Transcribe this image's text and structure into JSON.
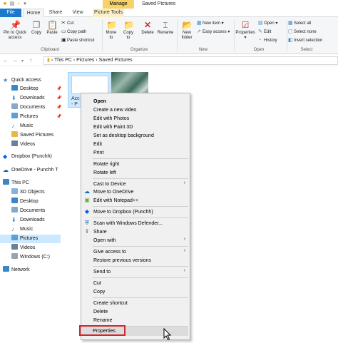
{
  "titlebar": {
    "manage_tab": "Manage",
    "title": "Saved Pictures"
  },
  "tabs": {
    "file": "File",
    "home": "Home",
    "share": "Share",
    "view": "View",
    "picture_tools": "Picture Tools"
  },
  "ribbon": {
    "clipboard": {
      "pin_quick_access": "Pin to Quick access",
      "copy": "Copy",
      "paste": "Paste",
      "cut": "Cut",
      "copy_path": "Copy path",
      "paste_shortcut": "Paste shortcut",
      "label": "Clipboard"
    },
    "organize": {
      "move_to": "Move to",
      "copy_to": "Copy to",
      "delete": "Delete",
      "rename": "Rename",
      "label": "Organize"
    },
    "new": {
      "new_folder": "New folder",
      "new_item": "New item",
      "easy_access": "Easy access",
      "label": "New"
    },
    "open": {
      "properties": "Properties",
      "open": "Open",
      "edit": "Edit",
      "history": "History",
      "label": "Open"
    },
    "select": {
      "select_all": "Select all",
      "select_none": "Select none",
      "invert_selection": "Invert selection",
      "label": "Select"
    }
  },
  "address": {
    "path": "›  This PC  ›  Pictures  ›  Saved Pictures"
  },
  "navpane": {
    "quick_access": "Quick access",
    "desktop": "Desktop",
    "downloads": "Downloads",
    "documents": "Documents",
    "pictures": "Pictures",
    "music": "Music",
    "saved_pictures": "Saved Pictures",
    "videos": "Videos",
    "dropbox": "Dropbox (Punchh)",
    "onedrive": "OneDrive - Punchh T",
    "this_pc": "This PC",
    "objects3d": "3D Objects",
    "pc_desktop": "Desktop",
    "pc_documents": "Documents",
    "pc_downloads": "Downloads",
    "pc_music": "Music",
    "pc_pictures": "Pictures",
    "pc_videos": "Videos",
    "windows_c": "Windows (C:)",
    "network": "Network"
  },
  "content": {
    "thumb1_caption_line1": "Acc",
    "thumb1_caption_line2": "- P"
  },
  "context_menu": {
    "open": "Open",
    "create_video": "Create a new video",
    "edit_photos": "Edit with Photos",
    "edit_paint3d": "Edit with Paint 3D",
    "set_background": "Set as desktop background",
    "edit": "Edit",
    "print": "Print",
    "rotate_right": "Rotate right",
    "rotate_left": "Rotate left",
    "cast": "Cast to Device",
    "move_onedrive": "Move to OneDrive",
    "edit_notepad": "Edit with Notepad++",
    "move_dropbox": "Move to Dropbox (Punchh)",
    "scan_defender": "Scan with Windows Defender...",
    "share": "Share",
    "open_with": "Open with",
    "give_access": "Give access to",
    "restore_versions": "Restore previous versions",
    "send_to": "Send to",
    "cut": "Cut",
    "copy": "Copy",
    "create_shortcut": "Create shortcut",
    "delete": "Delete",
    "rename": "Rename",
    "properties": "Properties"
  },
  "colors": {
    "file_tab": "#1979ca",
    "manage_tab": "#f5d36a",
    "selection": "#cce8ff",
    "highlight_box": "#d1262b"
  }
}
